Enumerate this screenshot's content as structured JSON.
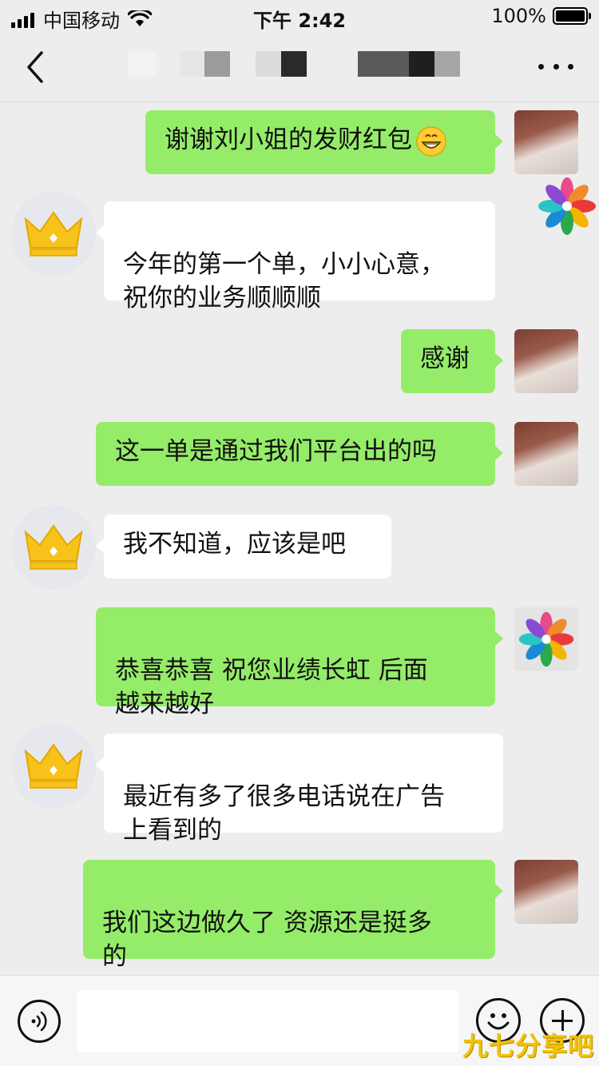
{
  "status_bar": {
    "carrier": "中国移动",
    "time": "下午 2:42",
    "battery": "100%",
    "battery_level": 1.0,
    "icons": [
      "signal-icon",
      "wifi-icon",
      "battery-icon"
    ]
  },
  "nav": {
    "back_icon": "chevron-left-icon",
    "more_icon": "more-dots-icon"
  },
  "colors": {
    "sent_bubble": "#95ec69",
    "received_bubble": "#ffffff",
    "background": "#ededed",
    "crown": "#f7c21a"
  },
  "messages": [
    {
      "direction": "sent",
      "text": "谢谢刘小姐的发财红包",
      "emoji": "grinning-face-icon"
    },
    {
      "direction": "received",
      "text": "今年的第一个单，小小心意，\n祝你的业务顺顺顺"
    },
    {
      "direction": "sent",
      "text": "感谢"
    },
    {
      "direction": "sent",
      "text": "这一单是通过我们平台出的吗"
    },
    {
      "direction": "received",
      "text": "我不知道，应该是吧"
    },
    {
      "direction": "sent",
      "text": "恭喜恭喜  祝您业绩长虹  后面\n越来越好"
    },
    {
      "direction": "received",
      "text": "最近有多了很多电话说在广告\n上看到的"
    },
    {
      "direction": "sent",
      "text": "我们这边做久了  资源还是挺多\n的"
    }
  ],
  "input_bar": {
    "voice_icon": "voice-icon",
    "emoji_icon": "smiley-icon",
    "plus_icon": "plus-icon",
    "input_value": ""
  },
  "watermark": "九七分享吧"
}
